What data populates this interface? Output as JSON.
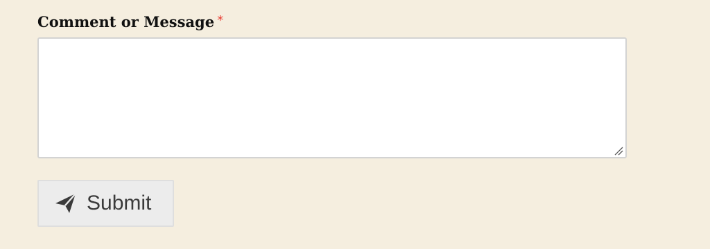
{
  "form": {
    "message_field": {
      "label": "Comment or Message",
      "required_marker": "*",
      "value": ""
    },
    "submit_button": {
      "icon": "paper-plane-icon",
      "label": "Submit"
    }
  },
  "colors": {
    "page_background": "#f5eedf",
    "required_marker": "#e8392f",
    "button_background": "#ececec",
    "textarea_border": "#d3d3d3"
  }
}
